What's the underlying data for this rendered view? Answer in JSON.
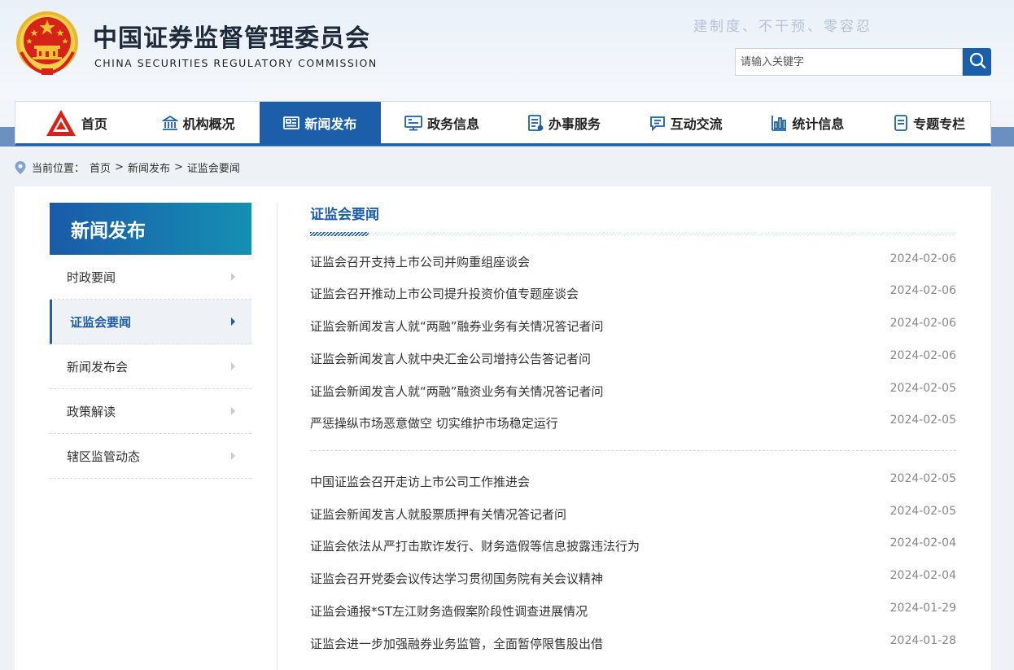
{
  "header": {
    "title_cn": "中国证券监督管理委员会",
    "title_en": "CHINA SECURITIES REGULATORY COMMISSION",
    "slogan": "建制度、不干预、零容忍",
    "search": {
      "placeholder": "请输入关键字",
      "value": ""
    }
  },
  "nav": [
    {
      "label": "首页",
      "icon": "logo-icon"
    },
    {
      "label": "机构概况",
      "icon": "institution-icon"
    },
    {
      "label": "新闻发布",
      "icon": "news-icon",
      "active": true
    },
    {
      "label": "政务信息",
      "icon": "monitor-icon"
    },
    {
      "label": "办事服务",
      "icon": "document-icon"
    },
    {
      "label": "互动交流",
      "icon": "chat-icon"
    },
    {
      "label": "统计信息",
      "icon": "chart-icon"
    },
    {
      "label": "专题专栏",
      "icon": "page-icon"
    }
  ],
  "breadcrumb": {
    "prefix": "当前位置：",
    "items": [
      "首页",
      "新闻发布",
      "证监会要闻"
    ],
    "separator": ">"
  },
  "sidebar": {
    "title": "新闻发布",
    "items": [
      {
        "label": "时政要闻"
      },
      {
        "label": "证监会要闻",
        "active": true
      },
      {
        "label": "新闻发布会"
      },
      {
        "label": "政策解读"
      },
      {
        "label": "辖区监管动态"
      }
    ]
  },
  "main": {
    "section_title": "证监会要闻",
    "news": [
      {
        "title": "证监会召开支持上市公司并购重组座谈会",
        "date": "2024-02-06"
      },
      {
        "title": "证监会召开推动上市公司提升投资价值专题座谈会",
        "date": "2024-02-06"
      },
      {
        "title": "证监会新闻发言人就“两融”融券业务有关情况答记者问",
        "date": "2024-02-06"
      },
      {
        "title": "证监会新闻发言人就中央汇金公司增持公告答记者问",
        "date": "2024-02-06"
      },
      {
        "title": "证监会新闻发言人就“两融”融资业务有关情况答记者问",
        "date": "2024-02-05"
      },
      {
        "title": "严惩操纵市场恶意做空 切实维护市场稳定运行",
        "date": "2024-02-05"
      },
      {
        "title": "中国证监会召开走访上市公司工作推进会",
        "date": "2024-02-05"
      },
      {
        "title": "证监会新闻发言人就股票质押有关情况答记者问",
        "date": "2024-02-05"
      },
      {
        "title": "证监会依法从严打击欺诈发行、财务造假等信息披露违法行为",
        "date": "2024-02-04"
      },
      {
        "title": "证监会召开党委会议传达学习贯彻国务院有关会议精神",
        "date": "2024-02-04"
      },
      {
        "title": "证监会通报*ST左江财务造假案阶段性调查进展情况",
        "date": "2024-01-29"
      },
      {
        "title": "证监会进一步加强融券业务监管，全面暂停限售股出借",
        "date": "2024-01-28"
      }
    ]
  },
  "colors": {
    "primary": "#1c5ea9",
    "sidebar_gradient_end": "#1590b3",
    "emblem_red": "#d6231a",
    "emblem_gold": "#f2c230"
  }
}
